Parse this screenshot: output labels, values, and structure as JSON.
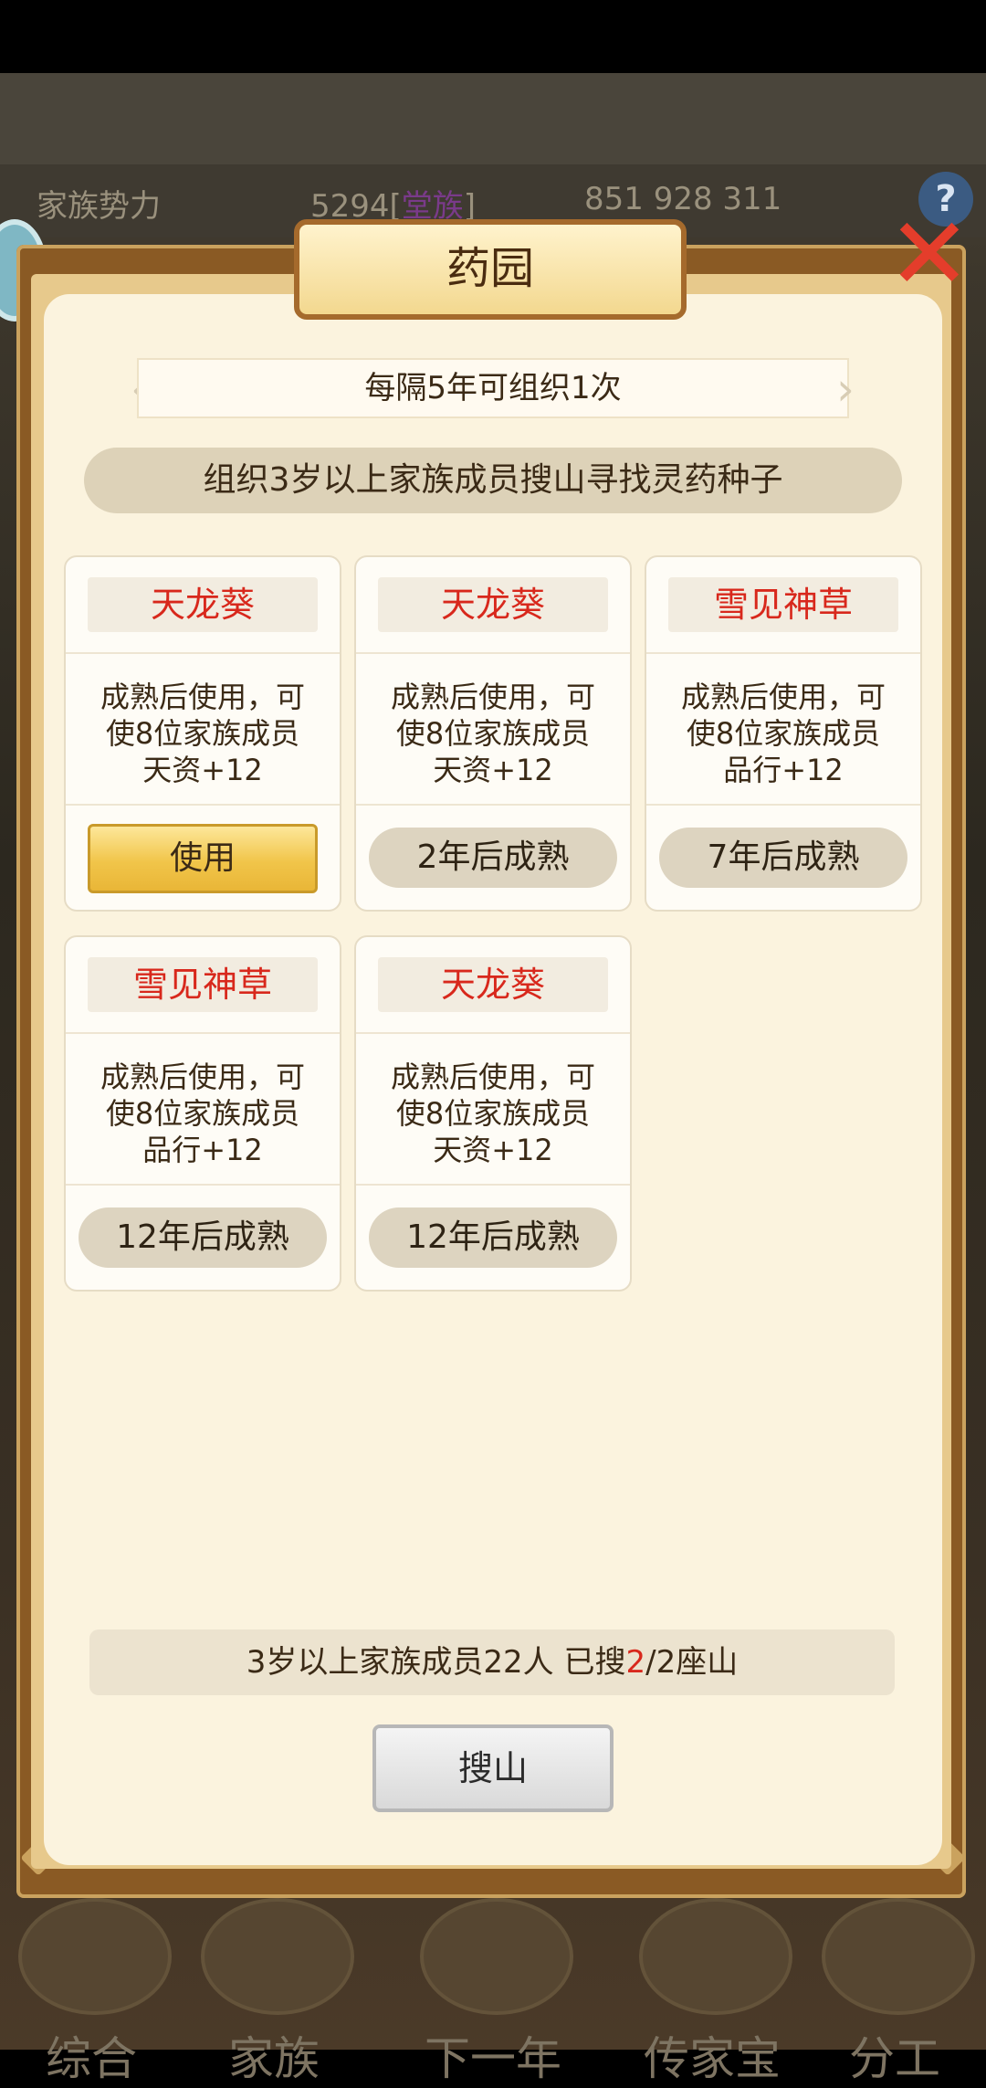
{
  "background": {
    "topbar": {
      "label": "家族势力",
      "power": "5294[",
      "power_rank": "堂族",
      "power_close": "]",
      "resources": "851 928 311"
    },
    "nav": [
      {
        "label": "综合",
        "icon": "scroll-icon"
      },
      {
        "label": "家族",
        "icon": "house-icon"
      },
      {
        "label": "下一年",
        "icon": "mountain-icon"
      },
      {
        "label": "传家宝",
        "icon": "treasure-icon"
      },
      {
        "label": "分工",
        "icon": "person-icon"
      }
    ]
  },
  "dialog": {
    "title": "药园",
    "close_icon": "close-icon",
    "banner": "每隔5年可组织1次",
    "description": "组织3岁以上家族成员搜山寻找灵药种子",
    "cards": [
      {
        "name": "天龙葵",
        "effect_line1": "成熟后使用，可",
        "effect_line2": "使8位家族成员",
        "effect_line3": "天资+12",
        "action": "使用",
        "ready": true
      },
      {
        "name": "天龙葵",
        "effect_line1": "成熟后使用，可",
        "effect_line2": "使8位家族成员",
        "effect_line3": "天资+12",
        "action": "2年后成熟",
        "ready": false
      },
      {
        "name": "雪见神草",
        "effect_line1": "成熟后使用，可",
        "effect_line2": "使8位家族成员",
        "effect_line3": "品行+12",
        "action": "7年后成熟",
        "ready": false
      },
      {
        "name": "雪见神草",
        "effect_line1": "成熟后使用，可",
        "effect_line2": "使8位家族成员",
        "effect_line3": "品行+12",
        "action": "12年后成熟",
        "ready": false
      },
      {
        "name": "天龙葵",
        "effect_line1": "成熟后使用，可",
        "effect_line2": "使8位家族成员",
        "effect_line3": "天资+12",
        "action": "12年后成熟",
        "ready": false
      }
    ],
    "footer": {
      "prefix": "3岁以上家族成员22人 已搜",
      "searched": "2",
      "suffix": "/2座山"
    },
    "search_button": "搜山"
  },
  "colors": {
    "frame": "#8a5a24",
    "panel": "#fbf3de",
    "herb_name": "#d8281c",
    "use_button": "#f1c54a"
  }
}
